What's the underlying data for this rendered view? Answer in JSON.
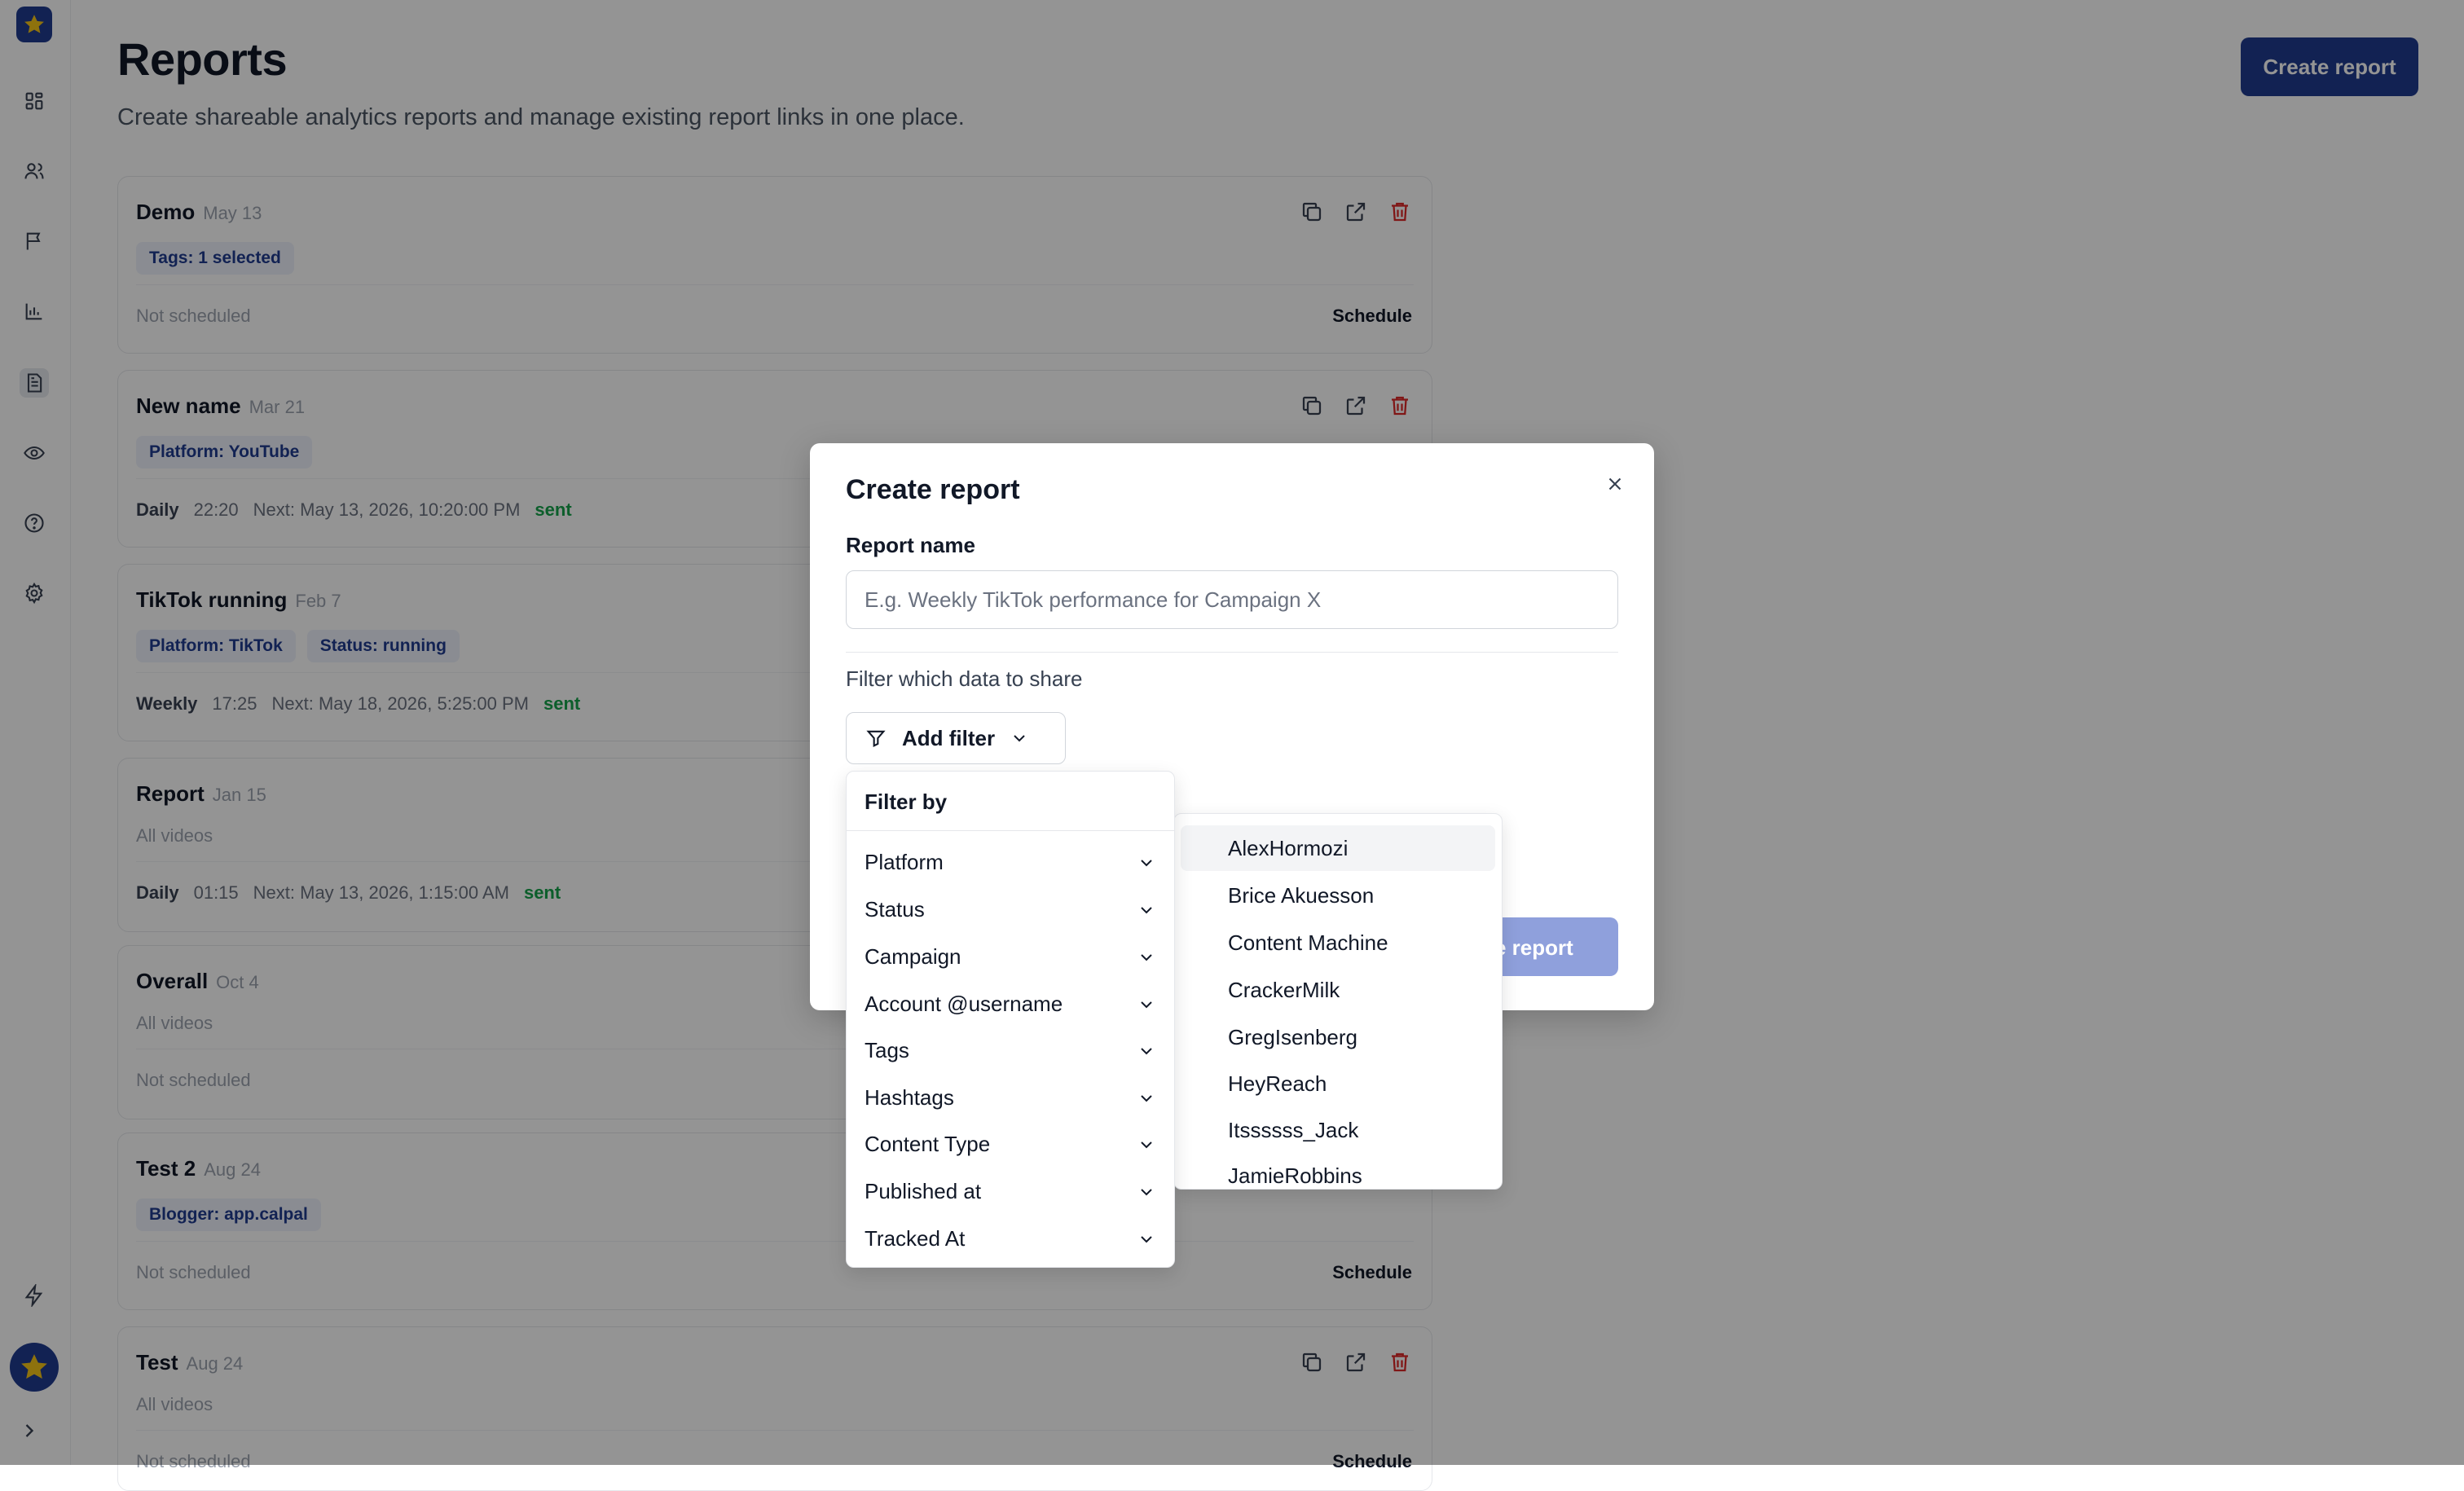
{
  "page": {
    "title": "Reports",
    "subtitle": "Create shareable analytics reports and manage existing report links in one place.",
    "create_button": "Create report"
  },
  "reports": [
    {
      "name": "Demo",
      "date": "May 13",
      "chips": [
        "Tags: 1 selected"
      ],
      "schedule": {
        "status": "Not scheduled",
        "link": "Schedule"
      }
    },
    {
      "name": "New name",
      "date": "Mar 21",
      "chips": [
        "Platform: YouTube"
      ],
      "schedule": {
        "frequency": "Daily",
        "time": "22:20",
        "next": "Next: May 13, 2026, 10:20:00 PM",
        "state": "sent"
      }
    },
    {
      "name": "TikTok running",
      "date": "Feb 7",
      "chips": [
        "Platform: TikTok",
        "Status: running"
      ],
      "schedule": {
        "frequency": "Weekly",
        "time": "17:25",
        "next": "Next: May 18, 2026, 5:25:00 PM",
        "state": "sent"
      }
    },
    {
      "name": "Report",
      "date": "Jan 15",
      "scope": "All videos",
      "schedule": {
        "frequency": "Daily",
        "time": "01:15",
        "next": "Next: May 13, 2026, 1:15:00 AM",
        "state": "sent"
      }
    },
    {
      "name": "Overall",
      "date": "Oct 4",
      "scope": "All videos",
      "schedule": {
        "status": "Not scheduled"
      }
    },
    {
      "name": "Test 2",
      "date": "Aug 24",
      "chips": [
        "Blogger: app.calpal"
      ],
      "schedule": {
        "status": "Not scheduled",
        "link": "Schedule"
      }
    },
    {
      "name": "Test",
      "date": "Aug 24",
      "scope": "All videos",
      "schedule": {
        "status": "Not scheduled",
        "link": "Schedule"
      }
    }
  ],
  "modal": {
    "title": "Create report",
    "report_name_label": "Report name",
    "report_name_placeholder": "E.g. Weekly TikTok performance for Campaign X",
    "filter_label": "Filter which data to share",
    "add_filter": "Add filter",
    "create_button": "Create report",
    "create_button_visible": "e report"
  },
  "filter_menu": {
    "title": "Filter by",
    "items": [
      "Platform",
      "Status",
      "Campaign",
      "Account @username",
      "Tags",
      "Hashtags",
      "Content Type",
      "Published at",
      "Tracked At"
    ]
  },
  "account_list": {
    "items": [
      "AlexHormozi",
      "Brice Akuesson",
      "Content Machine",
      "CrackerMilk",
      "GregIsenberg",
      "HeyReach",
      "Itssssss_Jack",
      "JamieRobbins"
    ]
  },
  "sidebar": {
    "icons": [
      "dashboard-icon",
      "users-icon",
      "flag-icon",
      "bar-chart-icon",
      "report-icon",
      "eye-icon",
      "help-icon",
      "settings-icon"
    ],
    "bottom_icons": [
      "bolt-icon",
      "avatar",
      "chevron-right-icon"
    ]
  },
  "colors": {
    "primary": "#1f3b8f",
    "primary_disabled": "#8fa0dc",
    "danger": "#dc2626",
    "success": "#16a34a"
  }
}
